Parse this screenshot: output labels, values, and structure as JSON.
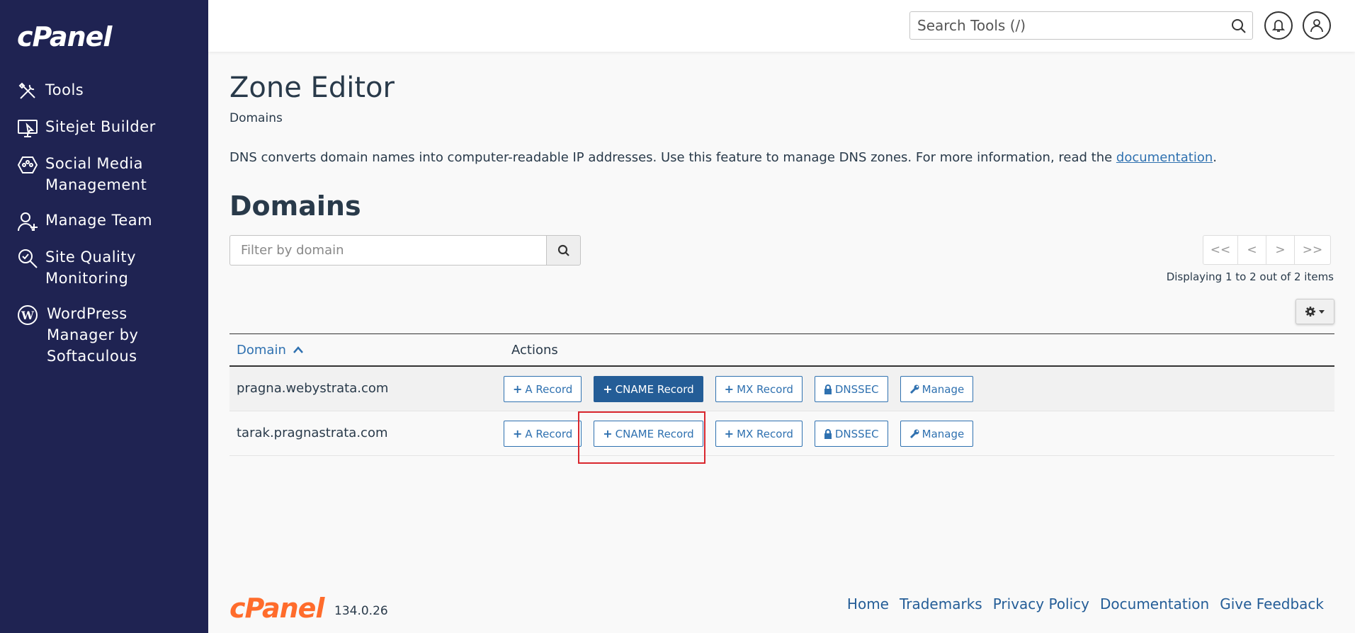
{
  "sidebar": {
    "logo": "cPanel",
    "items": [
      {
        "label": "Tools",
        "icon": "tools-icon"
      },
      {
        "label": "Sitejet Builder",
        "icon": "sitejet-icon"
      },
      {
        "label": "Social Media Management",
        "icon": "social-media-icon"
      },
      {
        "label": "Manage Team",
        "icon": "manage-team-icon"
      },
      {
        "label": "Site Quality Monitoring",
        "icon": "site-quality-icon"
      },
      {
        "label": "WordPress Manager by Softaculous",
        "icon": "wordpress-icon"
      }
    ]
  },
  "header": {
    "search_placeholder": "Search Tools (/)"
  },
  "page": {
    "title": "Zone Editor",
    "breadcrumb": "Domains",
    "description_text": "DNS converts domain names into computer-readable IP addresses. Use this feature to manage DNS zones. For more information, read the ",
    "description_link": "documentation",
    "description_end": ".",
    "section_title": "Domains"
  },
  "filter": {
    "placeholder": "Filter by domain"
  },
  "pager": {
    "first": "<<",
    "prev": "<",
    "next": ">",
    "last": ">>",
    "info": "Displaying 1 to 2 out of 2 items"
  },
  "table": {
    "col_domain": "Domain",
    "col_actions": "Actions",
    "rows": [
      {
        "domain": "pragna.webystrata.com"
      },
      {
        "domain": "tarak.pragnastrata.com"
      }
    ],
    "actions": {
      "a_record": "A Record",
      "cname_record": "CNAME Record",
      "mx_record": "MX Record",
      "dnssec": "DNSSEC",
      "manage": "Manage"
    }
  },
  "footer": {
    "logo": "cPanel",
    "version": "134.0.26",
    "links": [
      "Home",
      "Trademarks",
      "Privacy Policy",
      "Documentation",
      "Give Feedback"
    ]
  },
  "colors": {
    "sidebar_bg": "#1f2352",
    "link": "#2f71b0",
    "primary": "#245d97",
    "highlight": "#d9272e",
    "brand_orange": "#ff6c2c"
  }
}
